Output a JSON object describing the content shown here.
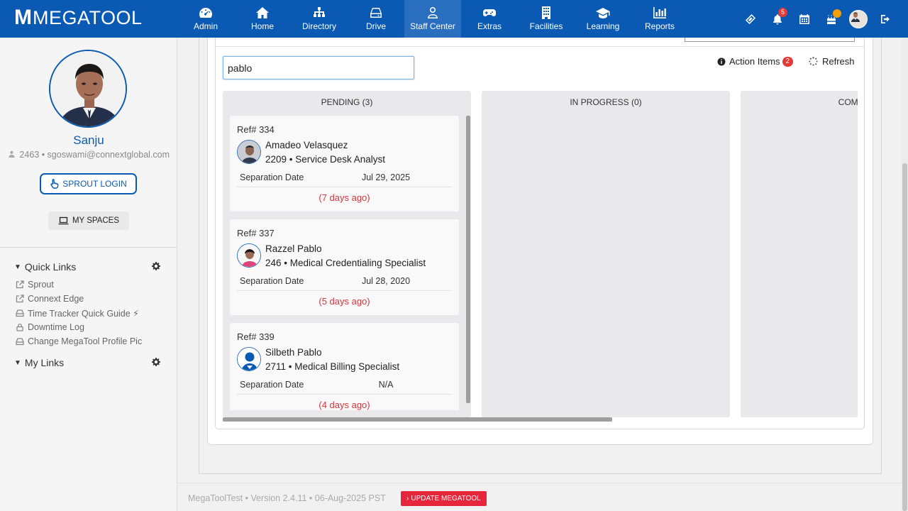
{
  "brand": {
    "m": "M",
    "text": "MEGATOOL"
  },
  "nav": [
    {
      "label": "Admin",
      "icon": "dashboard-icon"
    },
    {
      "label": "Home",
      "icon": "home-icon"
    },
    {
      "label": "Directory",
      "icon": "sitemap-icon"
    },
    {
      "label": "Drive",
      "icon": "drive-icon"
    },
    {
      "label": "Staff Center",
      "icon": "user-icon",
      "active": true
    },
    {
      "label": "Extras",
      "icon": "gamepad-icon"
    },
    {
      "label": "Facilities",
      "icon": "building-icon"
    },
    {
      "label": "Learning",
      "icon": "graduation-cap-icon"
    },
    {
      "label": "Reports",
      "icon": "bar-chart-icon"
    }
  ],
  "toolbar": {
    "notifications_count": "5"
  },
  "profile": {
    "name": "Sanju",
    "meta": "2463 • sgoswami@connextglobal.com",
    "sprout_login": "SPROUT LOGIN",
    "my_spaces": "MY SPACES"
  },
  "sidebar": {
    "quick_links_title": "Quick Links",
    "quick_links": [
      {
        "label": "Sprout",
        "icon": "external-link-icon"
      },
      {
        "label": "Connext Edge",
        "icon": "external-link-icon"
      },
      {
        "label": "Time Tracker Quick Guide ⚡",
        "icon": "drive-icon"
      },
      {
        "label": "Downtime Log",
        "icon": "lock-icon"
      },
      {
        "label": "Change MegaTool Profile Pic",
        "icon": "drive-icon"
      }
    ],
    "my_links_title": "My Links"
  },
  "main": {
    "search_value": "pablo",
    "action_items_label": "Action Items",
    "action_items_count": "2",
    "refresh_label": "Refresh",
    "columns": [
      {
        "title": "PENDING (3)"
      },
      {
        "title": "IN PROGRESS (0)"
      },
      {
        "title": "COMPLETED"
      }
    ],
    "cards": [
      {
        "ref": "Ref# 334",
        "name": "Amadeo Velasquez",
        "role": "2209 • Service Desk Analyst",
        "sep_label": "Separation Date",
        "sep_value": "Jul 29, 2025",
        "ago": "(7 days ago)"
      },
      {
        "ref": "Ref# 337",
        "name": "Razzel Pablo",
        "role": "246 • Medical Credentialing Specialist",
        "sep_label": "Separation Date",
        "sep_value": "Jul 28, 2020",
        "ago": "(5 days ago)"
      },
      {
        "ref": "Ref# 339",
        "name": "Silbeth Pablo",
        "role": "2711 • Medical Billing Specialist",
        "sep_label": "Separation Date",
        "sep_value": "N/A",
        "ago": "(4 days ago)"
      }
    ]
  },
  "footer": {
    "text": "MegaToolTest • Version 2.4.11 • 06-Aug-2025 PST",
    "update_label": "UPDATE MEGATOOL"
  },
  "colors": {
    "brand": "#0a5ab4",
    "accent_red": "#e53935",
    "ago_red": "#d9343b"
  }
}
